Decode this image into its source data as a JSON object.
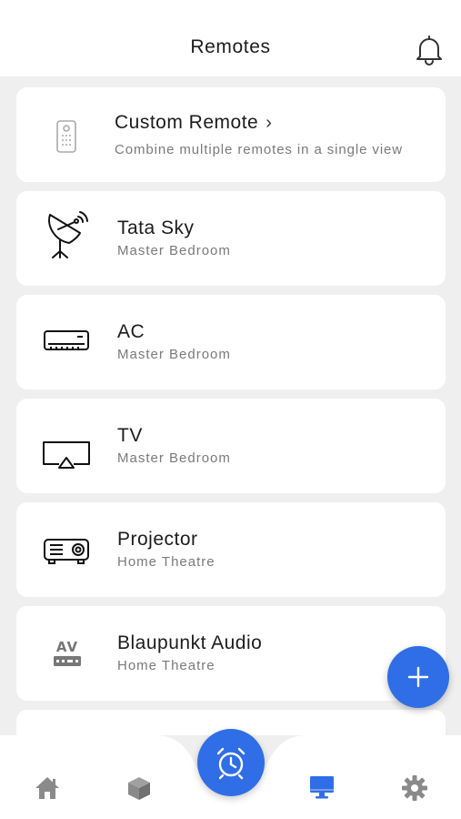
{
  "header": {
    "title": "Remotes",
    "notification_icon": "bell-icon"
  },
  "custom_remote": {
    "title": "Custom Remote",
    "subtitle": "Combine multiple remotes in a single view",
    "icon": "remote-control-icon"
  },
  "remotes": [
    {
      "name": "Tata Sky",
      "room": "Master Bedroom",
      "icon": "satellite-dish-icon"
    },
    {
      "name": "AC",
      "room": "Master Bedroom",
      "icon": "air-conditioner-icon"
    },
    {
      "name": "TV",
      "room": "Master Bedroom",
      "icon": "tv-icon"
    },
    {
      "name": "Projector",
      "room": "Home Theatre",
      "icon": "projector-icon"
    },
    {
      "name": "Blaupunkt Audio",
      "room": "Home Theatre",
      "icon": "av-receiver-icon"
    }
  ],
  "fab": {
    "icon": "plus-icon"
  },
  "tabbar": {
    "tabs": [
      {
        "name": "home",
        "icon": "home-icon",
        "active": false
      },
      {
        "name": "devices",
        "icon": "cube-icon",
        "active": false
      },
      {
        "name": "alarm",
        "icon": "alarm-clock-icon",
        "active": false
      },
      {
        "name": "remotes",
        "icon": "monitor-icon",
        "active": true
      },
      {
        "name": "settings",
        "icon": "gear-icon",
        "active": false
      }
    ]
  },
  "colors": {
    "accent": "#2f6ee6",
    "background": "#efefef",
    "card": "#ffffff",
    "inactive_icon": "#8a8a8a"
  }
}
